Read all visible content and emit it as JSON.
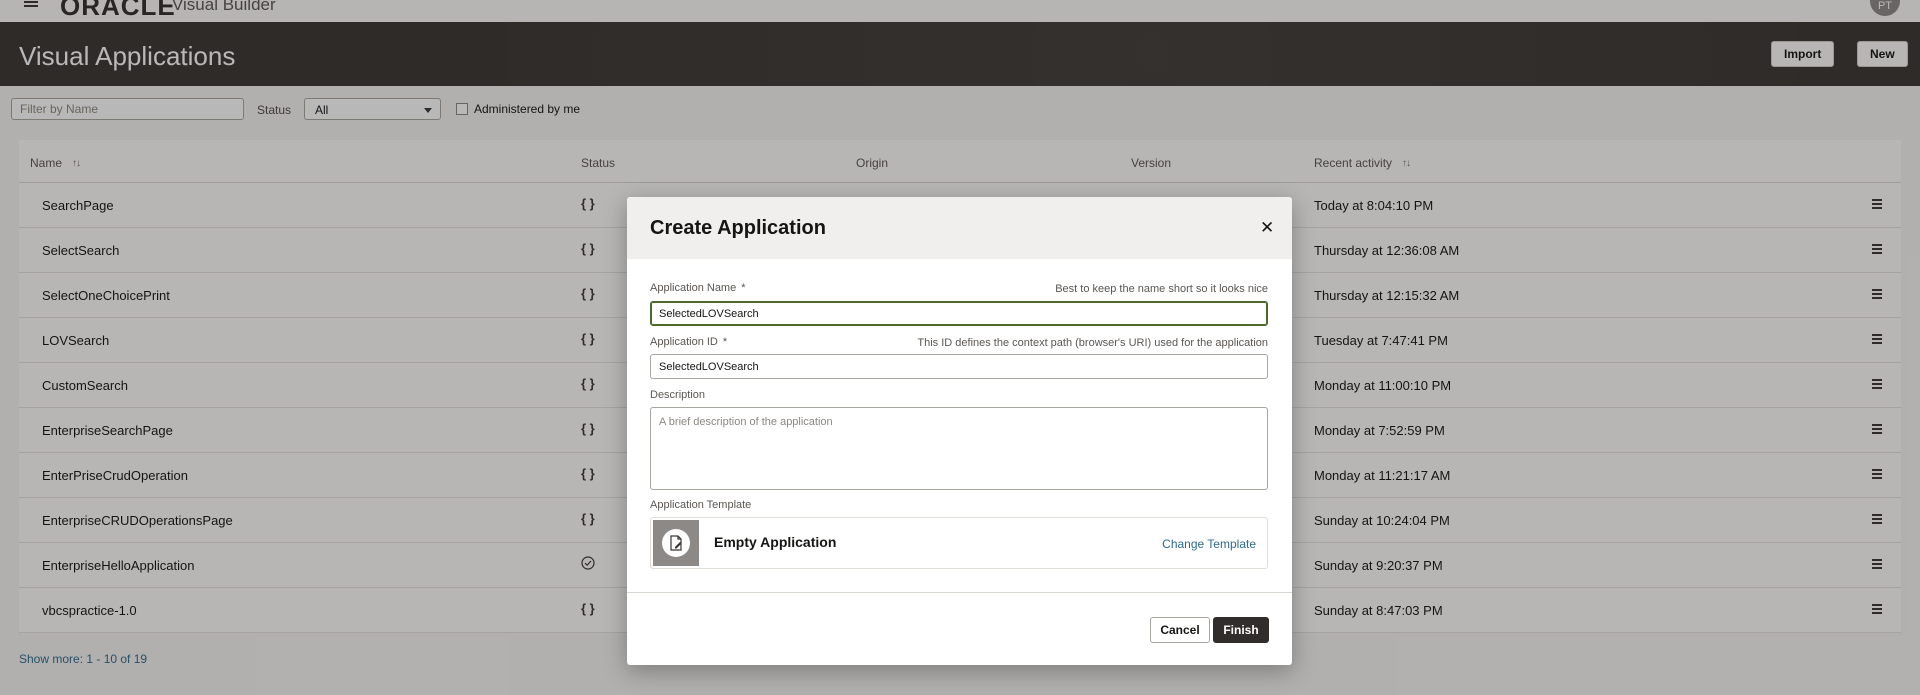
{
  "header": {
    "logo_text": "ORACLE",
    "product_name": "Visual Builder",
    "avatar_initials": "PT"
  },
  "banner": {
    "title": "Visual Applications",
    "import_label": "Import",
    "new_label": "New"
  },
  "filters": {
    "name_placeholder": "Filter by Name",
    "status_label": "Status",
    "status_value": "All",
    "administered_label": "Administered by me"
  },
  "table": {
    "columns": {
      "name": "Name",
      "status": "Status",
      "origin": "Origin",
      "version": "Version",
      "recent_activity": "Recent activity"
    },
    "rows": [
      {
        "name": "SearchPage",
        "status": "{ }",
        "activity": "Today at 8:04:10 PM"
      },
      {
        "name": "SelectSearch",
        "status": "{ }",
        "activity": "Thursday at 12:36:08 AM"
      },
      {
        "name": "SelectOneChoicePrint",
        "status": "{ }",
        "activity": "Thursday at 12:15:32 AM"
      },
      {
        "name": "LOVSearch",
        "status": "{ }",
        "activity": "Tuesday at 7:47:41 PM"
      },
      {
        "name": "CustomSearch",
        "status": "{ }",
        "activity": "Monday at 11:00:10 PM"
      },
      {
        "name": "EnterpriseSearchPage",
        "status": "{ }",
        "activity": "Monday at 7:52:59 PM"
      },
      {
        "name": "EnterPriseCrudOperation",
        "status": "{ }",
        "activity": "Monday at 11:21:17 AM"
      },
      {
        "name": "EnterpriseCRUDOperationsPage",
        "status": "{ }",
        "activity": "Sunday at 10:24:04 PM"
      },
      {
        "name": "EnterpriseHelloApplication",
        "status": "check-circle-icon",
        "activity": "Sunday at 9:20:37 PM"
      },
      {
        "name": "vbcspractice-1.0",
        "status": "{ }",
        "activity": "Sunday at 8:47:03 PM"
      }
    ],
    "show_more": "Show more: 1 - 10 of 19"
  },
  "dialog": {
    "title": "Create Application",
    "app_name_label": "Application Name",
    "app_name_hint": "Best to keep the name short so it looks nice",
    "app_name_value": "SelectedLOVSearch",
    "app_id_label": "Application ID",
    "app_id_hint": "This ID defines the context path (browser's URI) used for the application",
    "app_id_value": "SelectedLOVSearch",
    "description_label": "Description",
    "description_placeholder": "A brief description of the application",
    "required_marker": "*",
    "template_label": "Application Template",
    "template_name": "Empty Application",
    "change_template": "Change Template",
    "cancel_label": "Cancel",
    "finish_label": "Finish"
  },
  "colors": {
    "banner_bg": "#3a3632",
    "primary_button": "#312d2a",
    "link": "#2e6b8b",
    "focus_border": "#4d6a2a"
  }
}
